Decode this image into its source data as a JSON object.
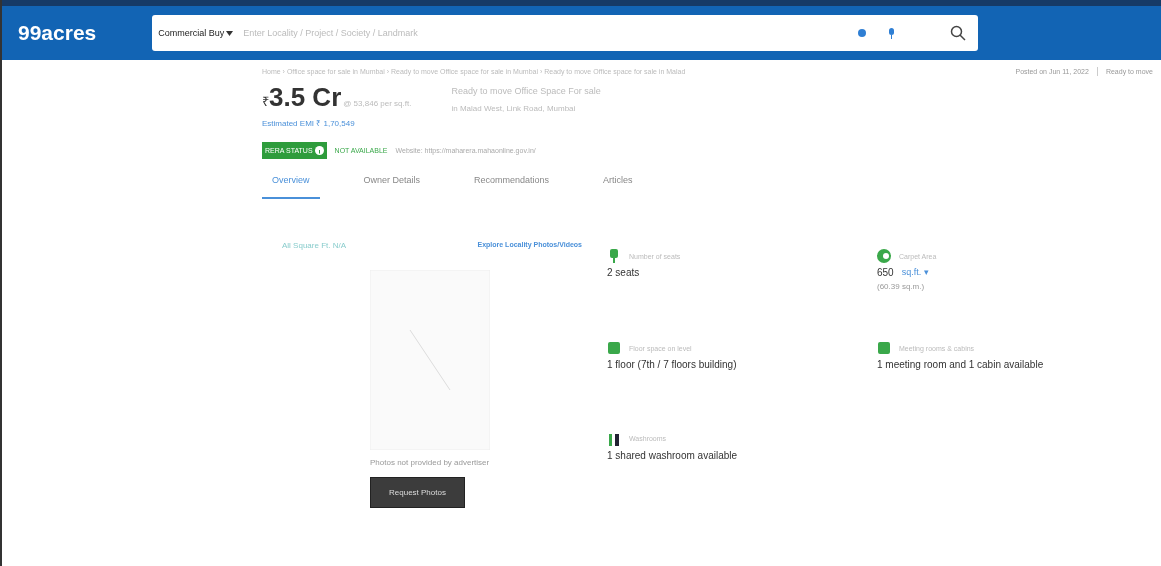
{
  "header": {
    "logo": "99acres",
    "search": {
      "category": "Commercial Buy",
      "placeholder": "Enter Locality / Project / Society / Landmark"
    }
  },
  "breadcrumb": "Home › Office space for sale in Mumbai › Ready to move Office space for sale in Mumbai › Ready to move Office space for sale in Malad",
  "posted": "Posted on Jun 11, 2022",
  "possession": "Ready to move",
  "price": {
    "symbol": "₹",
    "amount": "3.5 Cr",
    "per_sqft": "@ 53,846 per sq.ft.",
    "emi": "Estimated EMI ₹ 1,70,549"
  },
  "title": {
    "line1": "Ready to move Office Space For sale",
    "line2": "in Malad West, Link Road, Mumbai"
  },
  "rera": {
    "badge": "RERA STATUS",
    "status": "NOT AVAILABLE",
    "website": "Website: https://maharera.mahaonline.gov.in/"
  },
  "tabs": [
    {
      "label": "Overview",
      "selected": true
    },
    {
      "label": "Owner Details",
      "selected": false
    },
    {
      "label": "Recommendations",
      "selected": false
    },
    {
      "label": "Articles",
      "selected": false
    }
  ],
  "photos": {
    "area_note": "All Square Ft. N/A",
    "explore": "Explore Locality Photos/Videos",
    "note": "Photos not provided by advertiser",
    "button": "Request Photos"
  },
  "facts": [
    {
      "kind": "seat",
      "label": "Number of seats",
      "value": "2 seats"
    },
    {
      "kind": "area",
      "label": "Carpet Area",
      "value": "650",
      "unit": "sq.ft. ▾",
      "sub": "(60.39 sq.m.)"
    },
    {
      "kind": "floor",
      "label": "Floor space on level",
      "value": "1 floor (7th / 7 floors building)"
    },
    {
      "kind": "meeting",
      "label": "Meeting rooms & cabins",
      "value": "1 meeting room and 1 cabin available"
    },
    {
      "kind": "washroom",
      "label": "Washrooms",
      "value": "1 shared washroom available"
    }
  ]
}
